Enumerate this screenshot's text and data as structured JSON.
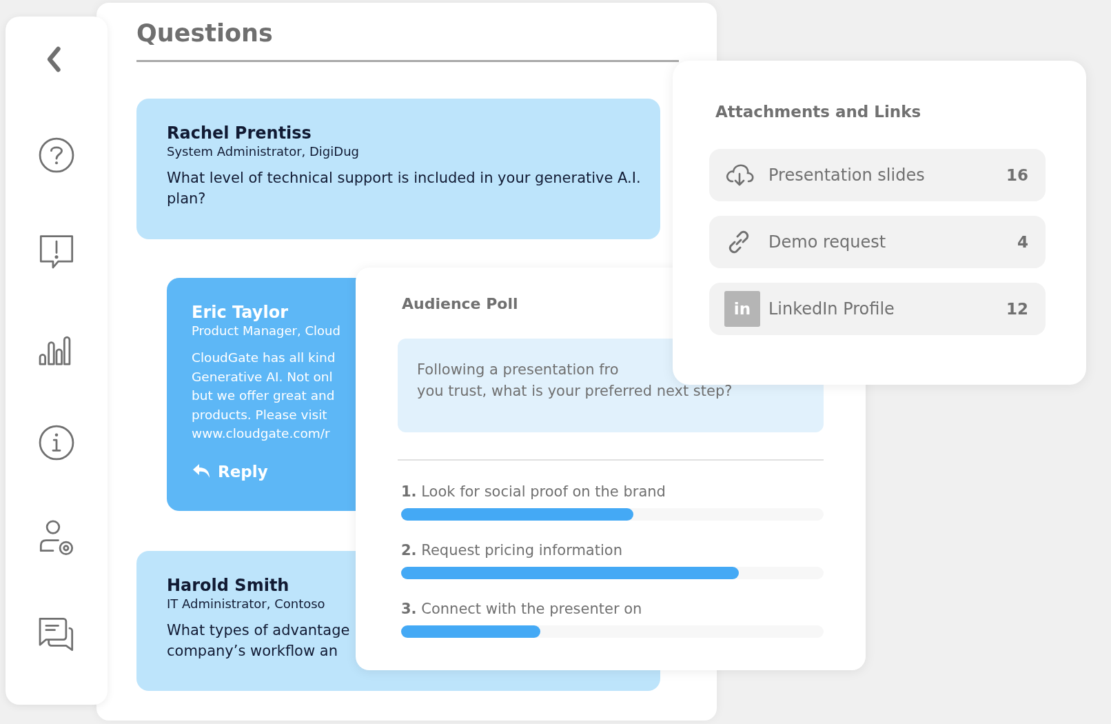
{
  "questions": {
    "title": "Questions",
    "items": [
      {
        "kind": "question",
        "name": "Rachel Prentiss",
        "role": "System Administrator, DigiDug",
        "text": "What level of technical support is included in your generative A.I. plan?"
      },
      {
        "kind": "answer",
        "name": "Eric Taylor",
        "role": "Product Manager, Cloud",
        "text": "CloudGate has all kind\nGenerative AI. Not onl\nbut we offer great and\nproducts. Please visit\nwww.cloudgate.com/r",
        "reply": "Reply"
      },
      {
        "kind": "question",
        "name": "Harold Smith",
        "role": "IT Administrator, Contoso",
        "text": "What types of advantage\ncompany’s workflow an"
      }
    ]
  },
  "poll": {
    "title": "Audience Poll",
    "question": "Following a presentation fro\nyou trust, what is your preferred next step?",
    "options": [
      {
        "label": "**1.** Look for social proof on the brand",
        "level": 0.55
      },
      {
        "label": "**2.** Request pricing information",
        "level": 0.8
      },
      {
        "label": "**3.** Connect with the presenter on",
        "level": 0.33
      }
    ]
  },
  "attachments": {
    "title": "Attachments and Links",
    "items": [
      {
        "kind": "file",
        "label": "Presentation slides",
        "count": "16"
      },
      {
        "kind": "link",
        "label": "Demo request",
        "count": "4"
      },
      {
        "kind": "profile",
        "icon_text": "in",
        "label": "LinkedIn Profile",
        "count": "12"
      }
    ]
  }
}
